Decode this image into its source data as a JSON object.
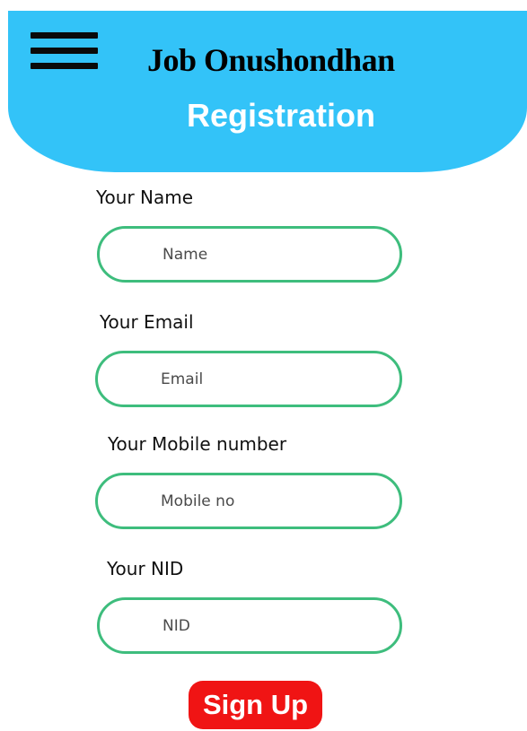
{
  "header": {
    "app_title": "Job Onushondhan",
    "page_title": "Registration",
    "menu_icon": "hamburger-menu-icon",
    "background_color": "#33c3f8"
  },
  "form": {
    "fields": [
      {
        "label": "Your Name",
        "placeholder": "Name",
        "value": ""
      },
      {
        "label": "Your Email",
        "placeholder": "Email",
        "value": ""
      },
      {
        "label": "Your Mobile number",
        "placeholder": "Mobile no",
        "value": ""
      },
      {
        "label": "Your NID",
        "placeholder": "NID",
        "value": ""
      }
    ],
    "field_border_color": "#3ebd7d",
    "submit_label": "Sign Up",
    "submit_color": "#f01414"
  }
}
